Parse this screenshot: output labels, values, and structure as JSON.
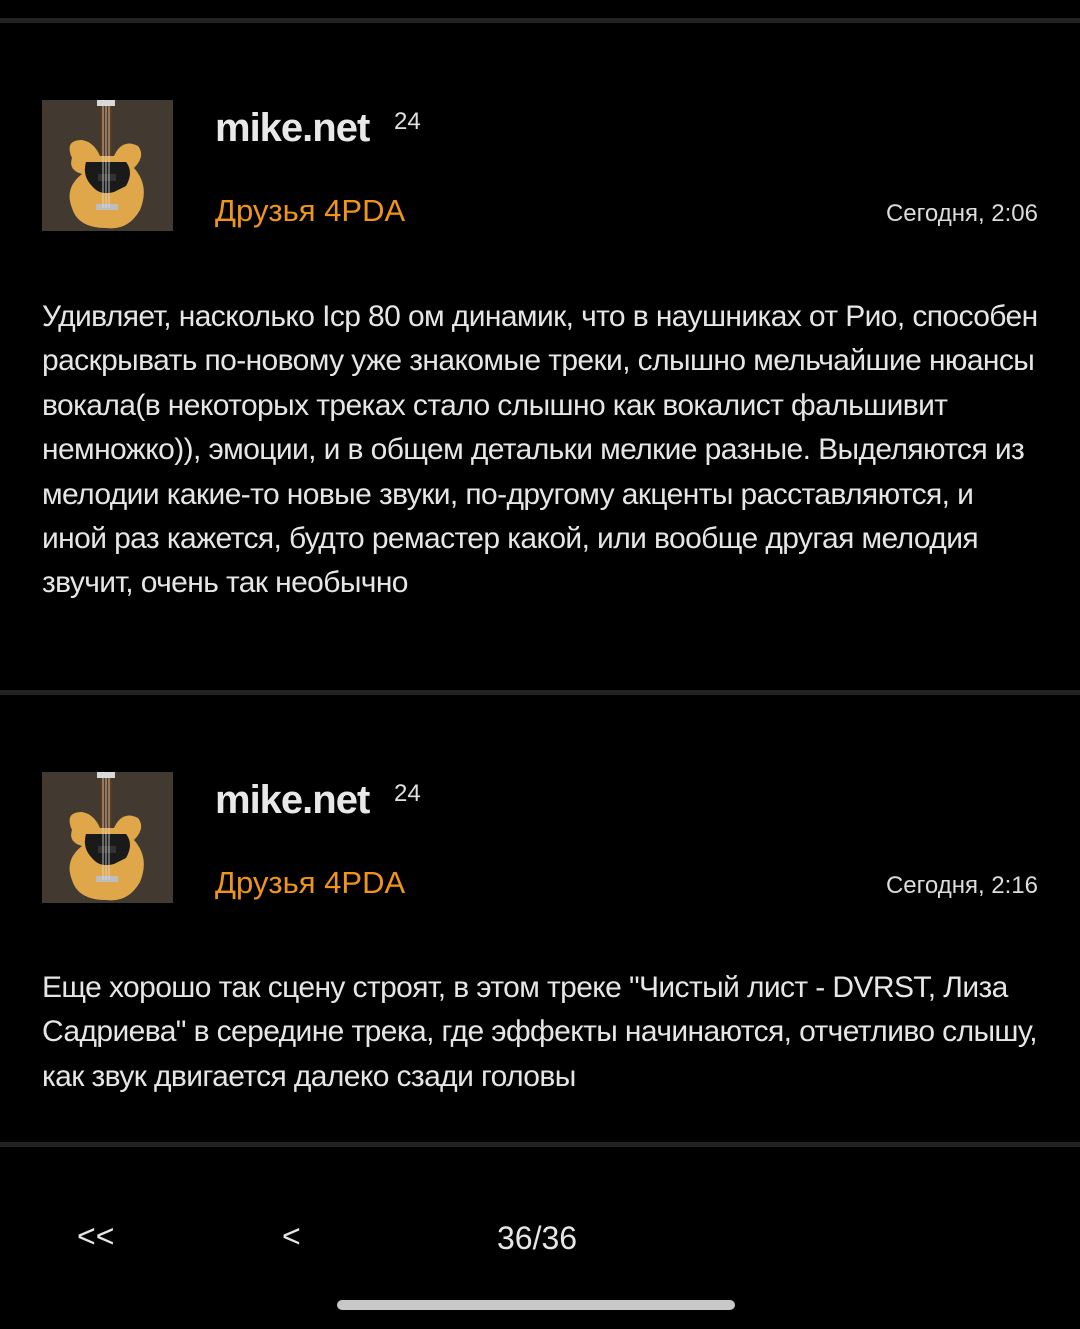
{
  "posts": [
    {
      "username": "mike.net",
      "reputation": "24",
      "group": "Друзья 4PDA",
      "date": "Сегодня, 2:06",
      "text": "Удивляет, насколько Icp 80 ом динамик, что в наушниках от Рио, способен раскрывать по-новому уже знакомые треки, слышно мельчайшие нюансы вокала(в некоторых треках стало слышно как вокалист фальшивит немножко)), эмоции, и в общем детальки мелкие разные. Выделяются из мелодии какие-то новые звуки, по-другому акценты расставляются, и иной раз кажется, будто ремастер какой, или вообще другая мелодия звучит, очень так необычно"
    },
    {
      "username": "mike.net",
      "reputation": "24",
      "group": "Друзья 4PDA",
      "date": "Сегодня, 2:16",
      "text": "Еще хорошо так сцену строят, в этом треке \"Чистый лист - DVRST, Лиза Садриева\" в середине трека, где эффекты начинаются, отчетливо слышу, как звук двигается далеко сзади головы"
    }
  ],
  "pager": {
    "first_label": "<<",
    "prev_label": "<",
    "page_indicator": "36/36"
  },
  "colors": {
    "background": "#000000",
    "group_accent": "#f0951b",
    "divider": "#222222"
  },
  "icons": {
    "avatar": "bass-guitar-avatar"
  }
}
